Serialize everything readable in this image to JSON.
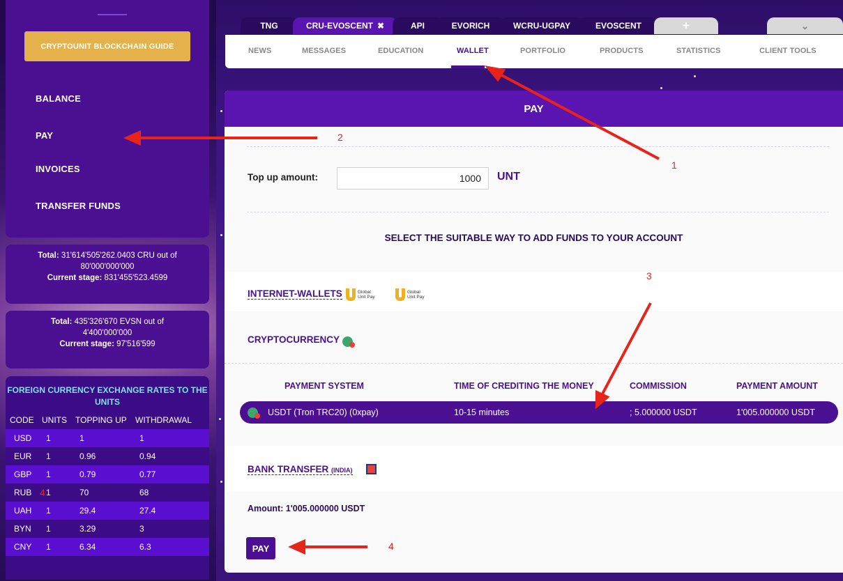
{
  "sidebar": {
    "guide_button": "CRYPTOUNIT BLOCKCHAIN GUIDE",
    "menu": [
      "BALANCE",
      "PAY",
      "INVOICES",
      "TRANSFER FUNDS"
    ],
    "cru_stats": {
      "total_label": "Total:",
      "total_value": "31'614'505'262.0403 CRU out of",
      "total_cap": "80'000'000'000",
      "stage_label": "Current stage:",
      "stage_value": "831'455'523.4599"
    },
    "evsn_stats": {
      "total_label": "Total:",
      "total_value": "435'326'670 EVSN out of",
      "total_cap": "4'400'000'000",
      "stage_label": "Current stage:",
      "stage_value": "97'516'599"
    },
    "rates": {
      "title_line1": "FOREIGN CURRENCY EXCHANGE RATES TO THE",
      "title_line2": "UNITS",
      "headers": [
        "CODE",
        "UNITS",
        "TOPPING UP",
        "WITHDRAWAL"
      ],
      "rows": [
        [
          "USD",
          "1",
          "1",
          "1"
        ],
        [
          "EUR",
          "1",
          "0.96",
          "0.94"
        ],
        [
          "GBP",
          "1",
          "0.79",
          "0.77"
        ],
        [
          "RUB",
          "1",
          "70",
          "68"
        ],
        [
          "UAH",
          "1",
          "29.4",
          "27.4"
        ],
        [
          "BYN",
          "1",
          "3.29",
          "3"
        ],
        [
          "CNY",
          "1",
          "6.34",
          "6.3"
        ]
      ]
    }
  },
  "tabs": [
    "TNG",
    "CRU-EVOSCENT",
    "API",
    "EVORICH",
    "WCRU-UGPAY",
    "EVOSCENT",
    "+",
    "⌄"
  ],
  "tab_close": "✖",
  "subnav": [
    "NEWS",
    "MESSAGES",
    "EDUCATION",
    "WALLET",
    "PORTFOLIO",
    "PRODUCTS",
    "STATISTICS",
    "CLIENT TOOLS"
  ],
  "main": {
    "header": "PAY",
    "topup_label": "Top up amount:",
    "topup_value": "1000",
    "unit": "UNT",
    "select_title": "SELECT THE SUITABLE WAY TO ADD FUNDS TO YOUR ACCOUNT",
    "internet_wallets": "INTERNET-WALLETS",
    "gup_text_1": "Global",
    "gup_text_2": "Unit Pay",
    "cryptocurrency": "CRYPTOCURRENCY",
    "table_headers": [
      "PAYMENT SYSTEM",
      "TIME OF CREDITING THE MONEY",
      "COMMISSION",
      "PAYMENT AMOUNT"
    ],
    "row": {
      "system": "USDT (Tron TRC20) (0xpay)",
      "time": "10-15 minutes",
      "commission": "; 5.000000 USDT",
      "amount": "1'005.000000 USDT"
    },
    "bank_transfer": "BANK TRANSFER",
    "bank_region": "(INDIA)",
    "amount_text": "Amount: 1'005.000000 USDT",
    "pay_button": "PAY"
  },
  "annotations": [
    "1",
    "2",
    "3",
    "4",
    "4"
  ],
  "colors": {
    "accent_purple": "#4a1091",
    "header_purple": "#5a14b0",
    "guide_gold": "#e5b14a",
    "arrow_red": "#e8231a"
  }
}
